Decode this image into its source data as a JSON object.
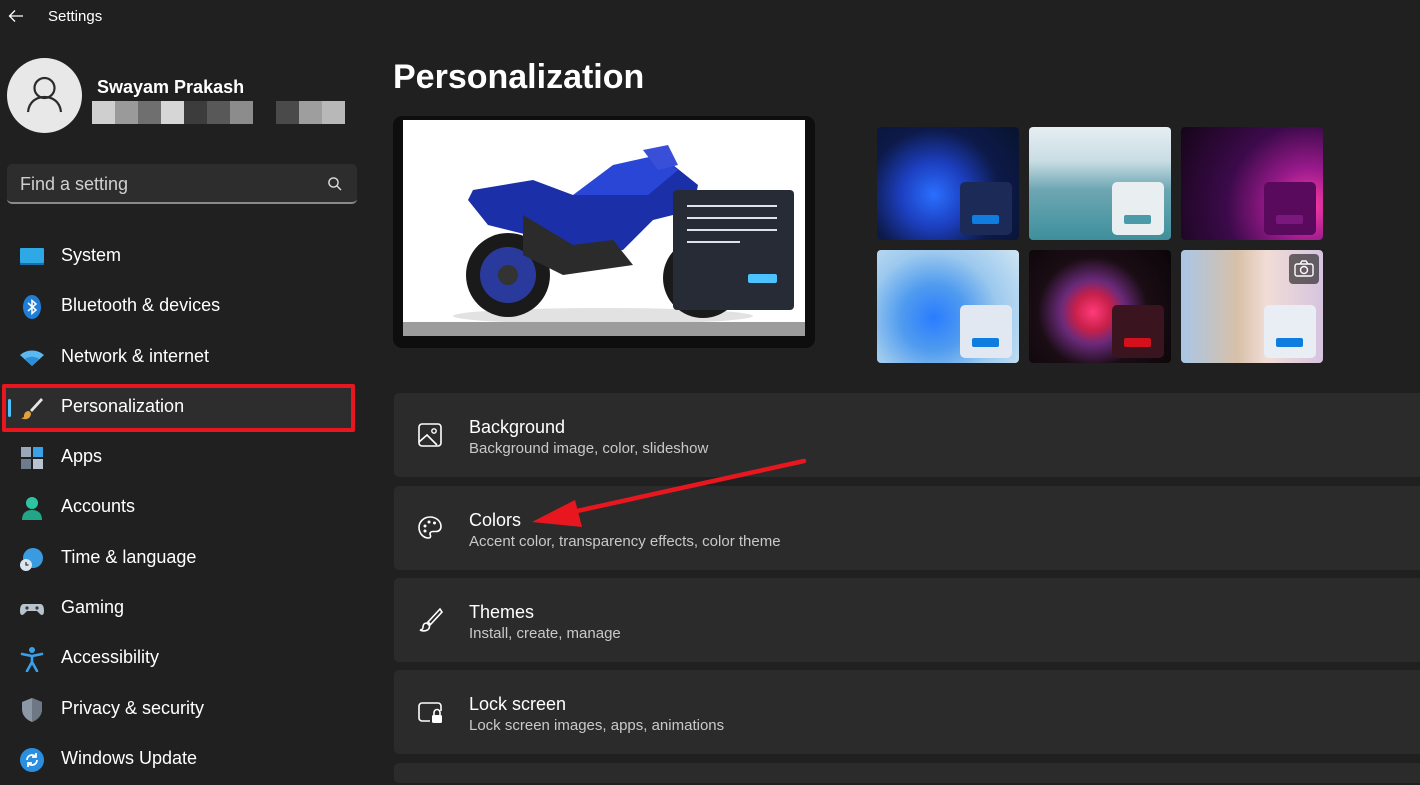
{
  "window": {
    "title": "Settings",
    "back_icon": "arrow-left-icon"
  },
  "user": {
    "name": "Swayam Prakash",
    "email_redacted_colors": [
      "#cfcfcf",
      "#9a9a9a",
      "#6f6f6f",
      "#d6d6d6",
      "#3c3c3c",
      "#585858",
      "#8c8c8c",
      "#202020",
      "#4a4a4a",
      "#9e9e9e",
      "#b8b8b8"
    ]
  },
  "search": {
    "placeholder": "Find a setting",
    "icon": "search-icon"
  },
  "sidebar": {
    "items": [
      {
        "label": "System",
        "icon": "monitor-icon"
      },
      {
        "label": "Bluetooth & devices",
        "icon": "bluetooth-icon"
      },
      {
        "label": "Network & internet",
        "icon": "wifi-icon"
      },
      {
        "label": "Personalization",
        "icon": "paintbrush-icon",
        "active": true
      },
      {
        "label": "Apps",
        "icon": "apps-icon"
      },
      {
        "label": "Accounts",
        "icon": "person-icon"
      },
      {
        "label": "Time & language",
        "icon": "globe-clock-icon"
      },
      {
        "label": "Gaming",
        "icon": "gamepad-icon"
      },
      {
        "label": "Accessibility",
        "icon": "accessibility-icon"
      },
      {
        "label": "Privacy & security",
        "icon": "shield-icon"
      },
      {
        "label": "Windows Update",
        "icon": "refresh-icon"
      }
    ]
  },
  "main": {
    "title": "Personalization",
    "settings": [
      {
        "title": "Background",
        "description": "Background image, color, slideshow",
        "icon": "image-icon"
      },
      {
        "title": "Colors",
        "description": "Accent color, transparency effects, color theme",
        "icon": "palette-icon"
      },
      {
        "title": "Themes",
        "description": "Install, create, manage",
        "icon": "brush-icon"
      },
      {
        "title": "Lock screen",
        "description": "Lock screen images, apps, animations",
        "icon": "lock-screen-icon"
      }
    ]
  },
  "colors": {
    "accent": "#4cc2ff",
    "highlight_box": "#e8171f",
    "annotation_arrow": "#e8171f"
  }
}
